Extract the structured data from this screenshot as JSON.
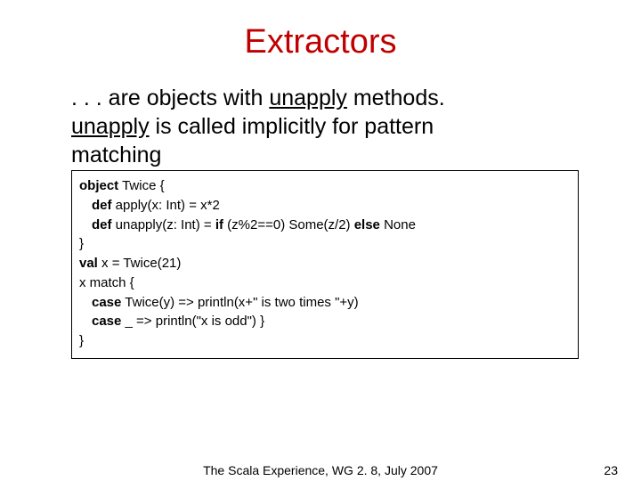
{
  "title": "Extractors",
  "body": {
    "line1_a": ". . . are objects with ",
    "line1_u": "unapply",
    "line1_b": " methods.",
    "line2_u": "unapply",
    "line2_a": " is called implicitly for pattern",
    "line3": "matching"
  },
  "code": {
    "l1_a": "object",
    "l1_b": " Twice {",
    "l2_a": "def",
    "l2_b": " apply(x: Int) = x*2",
    "l3_a": "def",
    "l3_b": " unapply(z: Int) = ",
    "l3_c": "if",
    "l3_d": " (z%2==0) Some(z/2) ",
    "l3_e": "else",
    "l3_f": " None",
    "l4": "}",
    "l5_a": "val",
    "l5_b": " x = Twice(21)",
    "l6": "x match {",
    "l7_a": "case",
    "l7_b": " Twice(y) => println(x+\" is two times \"+y)",
    "l8_a": "case",
    "l8_b": " _ => println(\"x is odd\") }",
    "l9": "}"
  },
  "footer": {
    "center": "The Scala Experience, WG 2. 8, July 2007",
    "page": "23"
  }
}
